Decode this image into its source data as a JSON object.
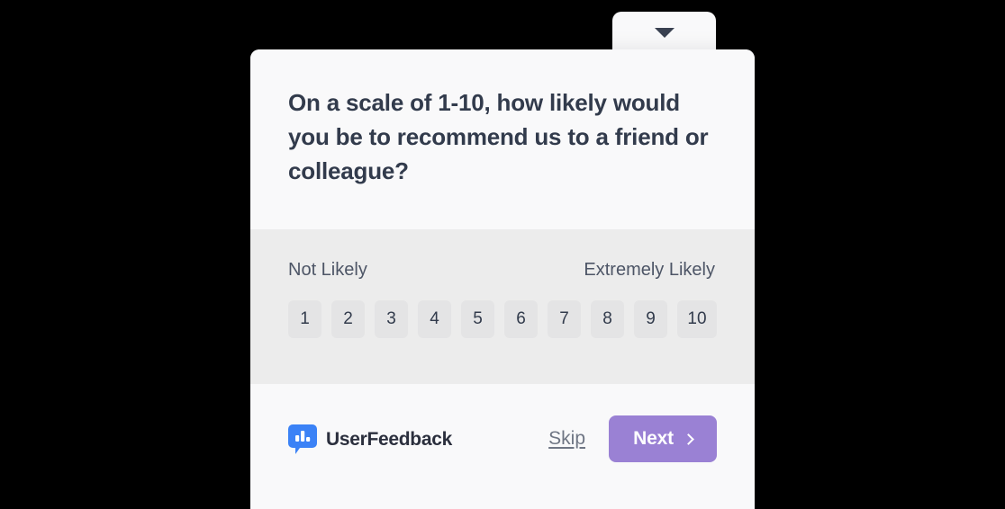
{
  "widget": {
    "collapse_tab": {
      "icon": "chevron-down-icon",
      "aria_label": "Collapse survey"
    },
    "question": {
      "text": "On a scale of 1-10, how likely would you be to recommend us to a friend or colleague?"
    },
    "rating": {
      "left_label": "Not Likely",
      "right_label": "Extremely Likely",
      "options": [
        "1",
        "2",
        "3",
        "4",
        "5",
        "6",
        "7",
        "8",
        "9",
        "10"
      ]
    },
    "footer": {
      "brand_name": "UserFeedback",
      "brand_icon": "speech-bubble-bar-chart-icon",
      "skip_label": "Skip",
      "next_label": "Next",
      "next_icon": "chevron-right-icon"
    },
    "colors": {
      "accent_purple": "#9a81d4",
      "brand_blue": "#3b82f6",
      "heading_text": "#323b4c",
      "panel_gray": "#ececec",
      "card_white": "#f9f9fa",
      "rating_chip": "#e4e4e5"
    }
  }
}
